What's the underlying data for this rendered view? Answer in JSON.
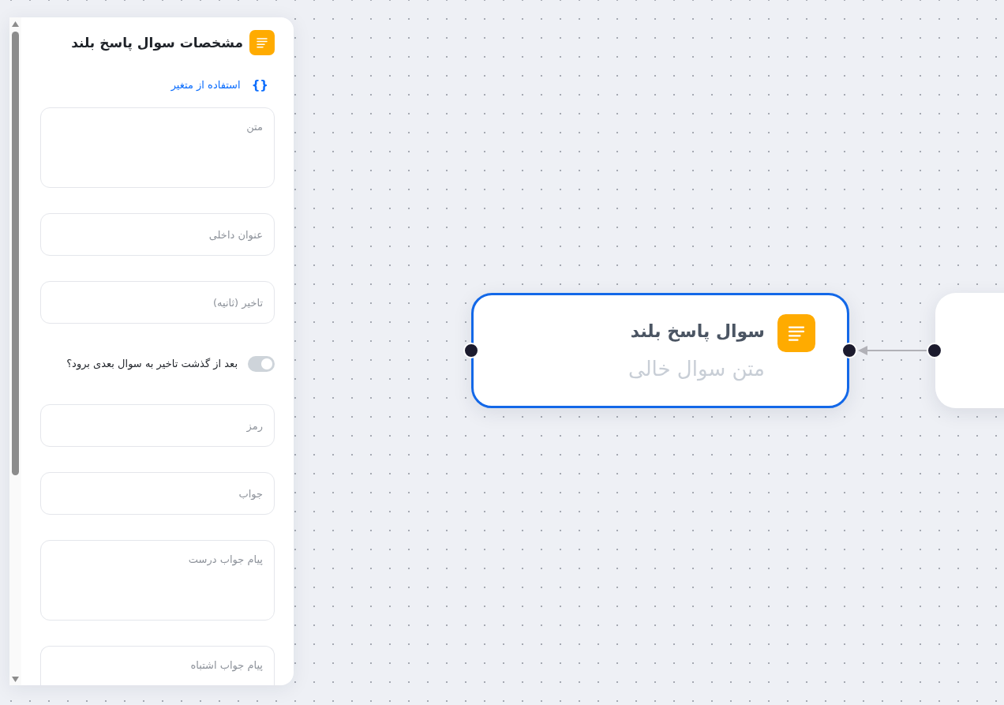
{
  "panel": {
    "title": "مشخصات سوال پاسخ بلند",
    "variable_link": {
      "icon": "{}",
      "label": "استفاده از متغیر"
    },
    "fields": [
      {
        "kind": "textarea",
        "placeholder": "متن"
      },
      {
        "kind": "input",
        "placeholder": "عنوان داخلی"
      },
      {
        "kind": "input",
        "placeholder": "تاخیر (ثانیه)"
      },
      {
        "kind": "switch",
        "label": "بعد از گذشت تاخیر به سوال بعدی برود؟",
        "on": false
      },
      {
        "kind": "input",
        "placeholder": "رمز"
      },
      {
        "kind": "input",
        "placeholder": "جواب"
      },
      {
        "kind": "textarea",
        "placeholder": "پیام جواب درست"
      },
      {
        "kind": "textarea",
        "placeholder": "پیام جواب اشتباه"
      }
    ]
  },
  "canvas": {
    "nodes": [
      {
        "title": "سوال پاسخ بلند",
        "subtitle": "متن سوال خالی",
        "selected": true
      },
      {
        "selected": false
      }
    ]
  }
}
